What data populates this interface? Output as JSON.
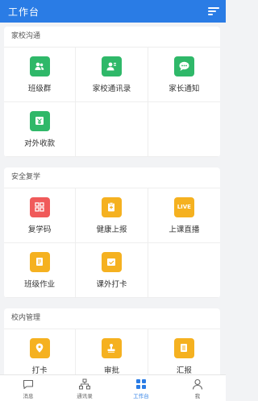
{
  "header": {
    "title": "工作台"
  },
  "sections": [
    {
      "title": "家校沟通",
      "items": [
        {
          "label": "班级群",
          "icon": "group-icon",
          "color": "#2fb869"
        },
        {
          "label": "家校通讯录",
          "icon": "contacts-icon",
          "color": "#2fb869"
        },
        {
          "label": "家长通知",
          "icon": "chat-bubble-icon",
          "color": "#2fb869"
        },
        {
          "label": "对外收款",
          "icon": "payment-icon",
          "color": "#2fb869"
        }
      ]
    },
    {
      "title": "安全复学",
      "items": [
        {
          "label": "复学码",
          "icon": "qr-code-icon",
          "color": "#f05a5a"
        },
        {
          "label": "健康上报",
          "icon": "health-report-icon",
          "color": "#f5b120"
        },
        {
          "label": "上课直播",
          "icon": "live-icon",
          "icon_text": "LIVE",
          "color": "#f5b120"
        },
        {
          "label": "班级作业",
          "icon": "homework-icon",
          "color": "#f5b120"
        },
        {
          "label": "课外打卡",
          "icon": "checkin-icon",
          "color": "#f5b120"
        }
      ]
    },
    {
      "title": "校内管理",
      "items": [
        {
          "label": "打卡",
          "icon": "location-icon",
          "color": "#f5b120"
        },
        {
          "label": "审批",
          "icon": "stamp-icon",
          "color": "#f5b120"
        },
        {
          "label": "汇报",
          "icon": "report-icon",
          "color": "#f5b120"
        }
      ]
    }
  ],
  "tabbar": {
    "items": [
      {
        "label": "消息",
        "icon": "message-icon"
      },
      {
        "label": "通讯录",
        "icon": "org-chart-icon"
      },
      {
        "label": "工作台",
        "icon": "workbench-icon",
        "active": true
      },
      {
        "label": "我",
        "icon": "user-icon"
      }
    ]
  },
  "colors": {
    "brand": "#2a7ce5",
    "green": "#2fb869",
    "orange": "#f5b120",
    "red": "#f05a5a"
  }
}
